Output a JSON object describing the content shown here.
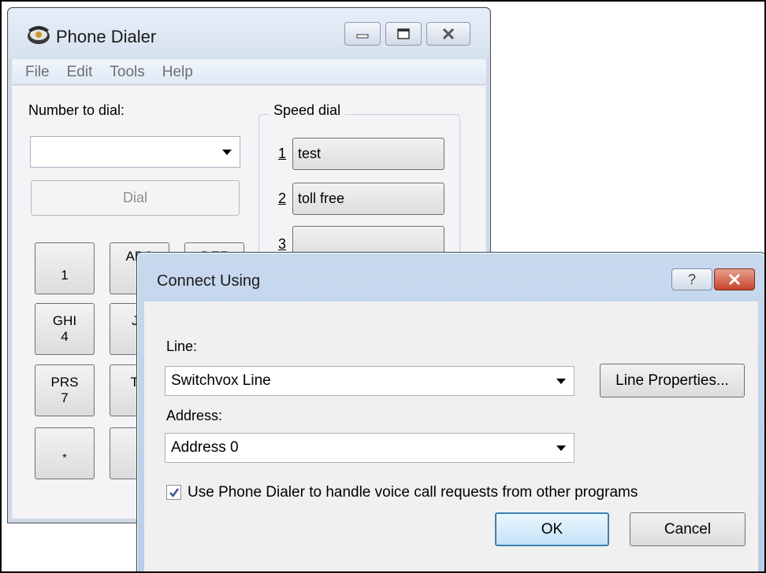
{
  "dialer": {
    "title": "Phone Dialer",
    "menu": [
      "File",
      "Edit",
      "Tools",
      "Help"
    ],
    "number_label": "Number to dial:",
    "number_value": "",
    "dial_label": "Dial",
    "speed_dial": {
      "label": "Speed dial",
      "items": [
        {
          "num": "1",
          "name": "test"
        },
        {
          "num": "2",
          "name": "toll free"
        },
        {
          "num": "3",
          "name": ""
        }
      ]
    },
    "keys": [
      {
        "letters": "",
        "digit": "1"
      },
      {
        "letters": "ABC",
        "digit": ""
      },
      {
        "letters": "DEF",
        "digit": ""
      },
      {
        "letters": "GHI",
        "digit": "4"
      },
      {
        "letters": "JK",
        "digit": ""
      },
      {
        "letters": "PRS",
        "digit": "7"
      },
      {
        "letters": "TU",
        "digit": ""
      },
      {
        "letters": "",
        "digit": "*"
      },
      {
        "letters": "",
        "digit": ""
      }
    ]
  },
  "connect": {
    "title": "Connect Using",
    "help_label": "?",
    "line_label": "Line:",
    "line_value": "Switchvox Line",
    "line_props_label": "Line Properties...",
    "address_label": "Address:",
    "address_value": "Address 0",
    "checkbox_label": "Use Phone Dialer to handle voice call requests from other programs",
    "checkbox_checked": true,
    "ok_label": "OK",
    "cancel_label": "Cancel"
  }
}
